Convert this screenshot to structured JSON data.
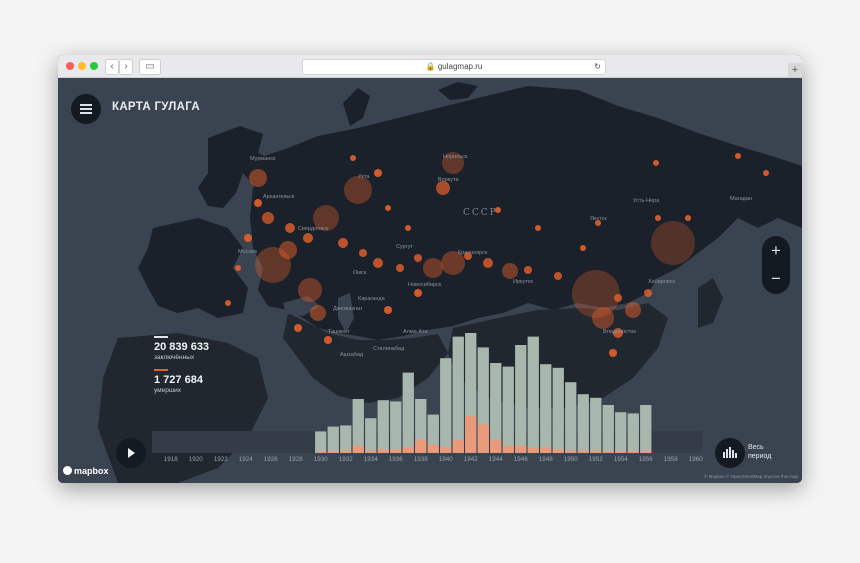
{
  "browser": {
    "url": "gulagmap.ru",
    "back_label": "‹",
    "forward_label": "›",
    "new_tab_label": "+"
  },
  "app": {
    "title": "КАРТА ГУЛАГА",
    "country_label": "СССР"
  },
  "stats": {
    "prisoners_value": "20 839 633",
    "prisoners_label": "заключённых",
    "died_value": "1 727 684",
    "died_label": "умерших"
  },
  "controls": {
    "zoom_in_label": "+",
    "zoom_out_label": "−",
    "all_period_label": "Весь период",
    "play_icon": "play-icon",
    "menu_icon": "hamburger-icon"
  },
  "footer": {
    "logo_text": "mapbox",
    "attribution": "© Mapbox © OpenStreetMap Improve this map"
  },
  "colors": {
    "prisoners_bar": "#a8b7ad",
    "died_bar": "#e99a7a",
    "camp_marker": "#e5602a",
    "map_background": "#3a4350",
    "land": "#1b212a"
  },
  "chart_data": {
    "type": "bar",
    "x": [
      1930,
      1931,
      1932,
      1933,
      1934,
      1935,
      1936,
      1937,
      1938,
      1939,
      1940,
      1941,
      1942,
      1943,
      1944,
      1945,
      1946,
      1947,
      1948,
      1949,
      1950,
      1951,
      1952,
      1953,
      1954,
      1955,
      1956
    ],
    "x_ticks": [
      "1918",
      "1920",
      "1922",
      "1924",
      "1926",
      "1928",
      "1930",
      "1932",
      "1934",
      "1936",
      "1938",
      "1940",
      "1942",
      "1944",
      "1946",
      "1948",
      "1950",
      "1952",
      "1954",
      "1956",
      "1958",
      "1960"
    ],
    "series": [
      {
        "name": "заключённых",
        "values": [
          18,
          22,
          23,
          45,
          29,
          44,
          43,
          67,
          45,
          32,
          79,
          97,
          100,
          88,
          75,
          72,
          90,
          97,
          74,
          71,
          59,
          49,
          46,
          40,
          34,
          33,
          40
        ]
      },
      {
        "name": "умерших",
        "values": [
          1,
          1,
          2,
          6,
          2,
          3,
          3,
          5,
          11,
          7,
          5,
          11,
          31,
          24,
          11,
          6,
          6,
          5,
          5,
          3,
          2,
          2,
          2,
          1,
          1,
          1,
          1
        ]
      }
    ],
    "xlim": [
      1917,
      1961
    ]
  },
  "map_labels": [
    "Мурманск",
    "Архангельск",
    "Ухта",
    "Норильск",
    "Воркута",
    "Сургут",
    "Якутск",
    "Магадан",
    "Усть-Нера",
    "Хабаровск",
    "Владивосток",
    "Омск",
    "Новосибирск",
    "Караганда",
    "Красноярск",
    "Иркутск",
    "Москва",
    "Свердловск",
    "Джезказган",
    "Ташкент",
    "Алма-Ата",
    "Сталинабад",
    "Ашхабад"
  ]
}
